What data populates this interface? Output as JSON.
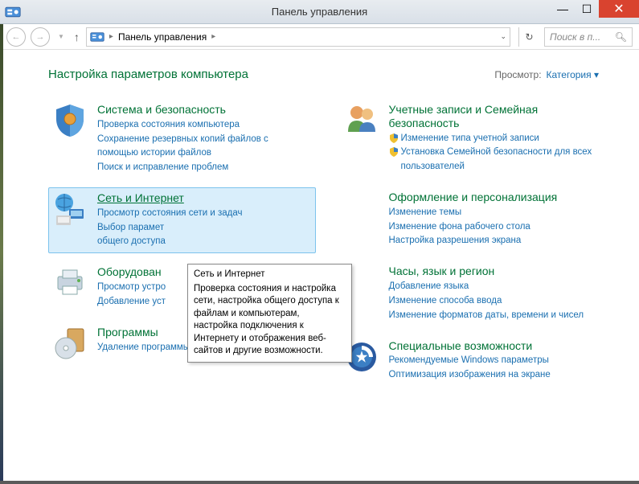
{
  "titlebar": {
    "title": "Панель управления"
  },
  "nav": {
    "breadcrumb": "Панель управления",
    "search_placeholder": "Поиск в п..."
  },
  "header": {
    "title": "Настройка параметров компьютера",
    "view_label": "Просмотр:",
    "view_value": "Категория"
  },
  "tooltip": {
    "title": "Сеть и Интернет",
    "body": "Проверка состояния и настройка сети, настройка общего доступа к файлам и компьютерам, настройка подключения к Интернету и отображения веб-сайтов и другие возможности."
  },
  "left": [
    {
      "title": "Система и безопасность",
      "links": [
        "Проверка состояния компьютера",
        "Сохранение резервных копий файлов с помощью истории файлов",
        "Поиск и исправление проблем"
      ]
    },
    {
      "title": "Сеть и Интернет",
      "links": [
        "Просмотр состояния сети и задач",
        "Выбор парамет",
        "общего доступа"
      ]
    },
    {
      "title": "Оборудован",
      "links": [
        "Просмотр устро",
        "Добавление уст"
      ]
    },
    {
      "title": "Программы",
      "links": [
        "Удаление программы"
      ]
    }
  ],
  "right": [
    {
      "title": "Учетные записи и Семейная безопасность",
      "shielded": [
        true,
        true
      ],
      "links": [
        "Изменение типа учетной записи",
        "Установка Семейной безопасности для всех пользователей"
      ]
    },
    {
      "title": "Оформление и персонализация",
      "links": [
        "Изменение темы",
        "Изменение фона рабочего стола",
        "Настройка разрешения экрана"
      ]
    },
    {
      "title": "Часы, язык и регион",
      "links": [
        "Добавление языка",
        "Изменение способа ввода",
        "Изменение форматов даты, времени и чисел"
      ]
    },
    {
      "title": "Специальные возможности",
      "links": [
        "Рекомендуемые Windows параметры",
        "Оптимизация изображения на экране"
      ]
    }
  ]
}
